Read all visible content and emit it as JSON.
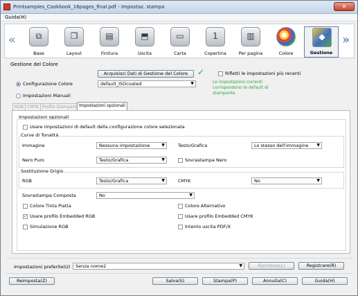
{
  "window": {
    "title": "Printsamples_Cookbook_16pages_final.pdf - Impostaz. stampa",
    "close": "✕"
  },
  "menu": {
    "help": "Guida(H)"
  },
  "nav": {
    "prev": "«",
    "next": "»"
  },
  "toolbar": {
    "items": [
      {
        "label": "Base",
        "icon": "base-icon",
        "glyph": "⧉"
      },
      {
        "label": "Layout",
        "icon": "layout-icon",
        "glyph": "❐"
      },
      {
        "label": "Finitura",
        "icon": "finishing-icon",
        "glyph": "▤"
      },
      {
        "label": "Uscita",
        "icon": "output-icon",
        "glyph": "⬒"
      },
      {
        "label": "Carta",
        "icon": "paper-icon",
        "glyph": "▭"
      },
      {
        "label": "Copertina",
        "icon": "cover-icon",
        "glyph": "1"
      },
      {
        "label": "Per pagina",
        "icon": "per-page-icon",
        "glyph": "▥"
      },
      {
        "label": "Colore",
        "icon": "color-icon",
        "glyph": ""
      },
      {
        "label": "Gestione",
        "icon": "color-management-icon",
        "glyph": "◆"
      }
    ],
    "active": "Gestione"
  },
  "gestione": {
    "section_label": "Gestione del Colore",
    "acquire_button": "Acquisisci Dati di Gestione del Colore",
    "reflect_label": "Rifletti le impostazioni più recenti",
    "radio_config": "Configurazione Colore",
    "config_value": "default_ISOcoated",
    "radio_manual": "Impostazioni Manuali",
    "note": "Le impostazioni correnti corrispondono le default di stampante.",
    "colors": {
      "accent": "#2fa43c",
      "selection": "#1f5bb6"
    }
  },
  "tabs": [
    {
      "label": "RGB"
    },
    {
      "label": "CMYK"
    },
    {
      "label": "Profilo Stampante"
    },
    {
      "label": "Impostazioni opzionali"
    }
  ],
  "optional": {
    "title": "Impostazioni opzionali",
    "use_default_label": "Usare impostazioni di default della configurazione colore selezionata",
    "tone_title": "Curve di Tonalità",
    "image_label": "Immagine",
    "image_value": "Nessuna impostazione",
    "text_graphics_label": "Testo/Grafica",
    "text_graphics_value": "Lo stesso dell'immagine",
    "pure_black_label": "Nero Puro",
    "pure_black_value": "Testo/Grafica",
    "overprint_black_label": "Sovrastampa Nero",
    "gray_title": "Sostituzione Grigio",
    "rgb_label": "RGB",
    "rgb_value": "Testo/Grafica",
    "cmyk_label": "CMYK",
    "cmyk_value": "No",
    "composite_label": "Sovrastampa Composta",
    "composite_value": "No",
    "flat_tint_label": "Colore Tinta Piatta",
    "alt_color_label": "Colore Alternativo",
    "embedded_rgb_label": "Usare profilo Embedded RGB",
    "embedded_cmyk_label": "Usare profilo Embedded CMYK",
    "sim_rgb_label": "Simulazione RGB",
    "pdfx_label": "Intento uscita PDF/X",
    "embedded_rgb_checked": "✓"
  },
  "presets": {
    "label": "Impostazioni preferite(U)",
    "value": "Senza nome2",
    "restore": "Ripristina(L)",
    "register": "Registrare(R)"
  },
  "footer": {
    "reset": "Reimposta(Z)",
    "save": "Salva(S)",
    "print": "Stampa(P)",
    "cancel": "Annulla(C)",
    "help": "Guida(H)"
  }
}
